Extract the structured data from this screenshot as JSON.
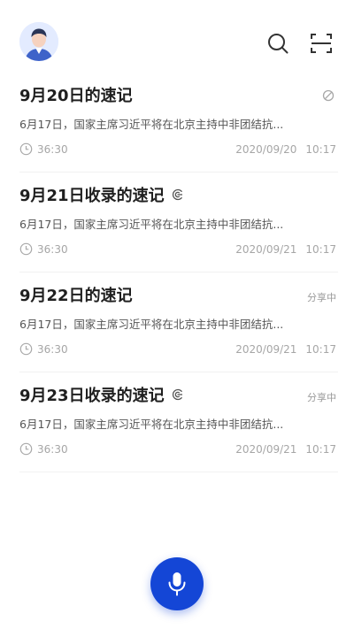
{
  "header": {
    "avatar": "user-avatar",
    "search_icon": "search-icon",
    "scan_icon": "scan-icon"
  },
  "notes": [
    {
      "title": "9月20日的速记",
      "title_icon": "",
      "status_text": "",
      "status_icon": "disabled-icon",
      "snippet": "6月17日，国家主席习近平将在北京主持中非团结抗...",
      "duration": "36:30",
      "date": "2020/09/20",
      "time": "10:17"
    },
    {
      "title": "9月21日收录的速记",
      "title_icon": "record-icon",
      "status_text": "",
      "status_icon": "",
      "snippet": "6月17日，国家主席习近平将在北京主持中非团结抗...",
      "duration": "36:30",
      "date": "2020/09/21",
      "time": "10:17"
    },
    {
      "title": "9月22日的速记",
      "title_icon": "",
      "status_text": "分享中",
      "status_icon": "",
      "snippet": "6月17日，国家主席习近平将在北京主持中非团结抗...",
      "duration": "36:30",
      "date": "2020/09/21",
      "time": "10:17"
    },
    {
      "title": "9月23日收录的速记",
      "title_icon": "record-icon",
      "status_text": "分享中",
      "status_icon": "",
      "snippet": "6月17日，国家主席习近平将在北京主持中非团结抗...",
      "duration": "36:30",
      "date": "2020/09/21",
      "time": "10:17"
    }
  ],
  "mic": {
    "icon": "microphone-icon",
    "color": "#1446d6"
  }
}
